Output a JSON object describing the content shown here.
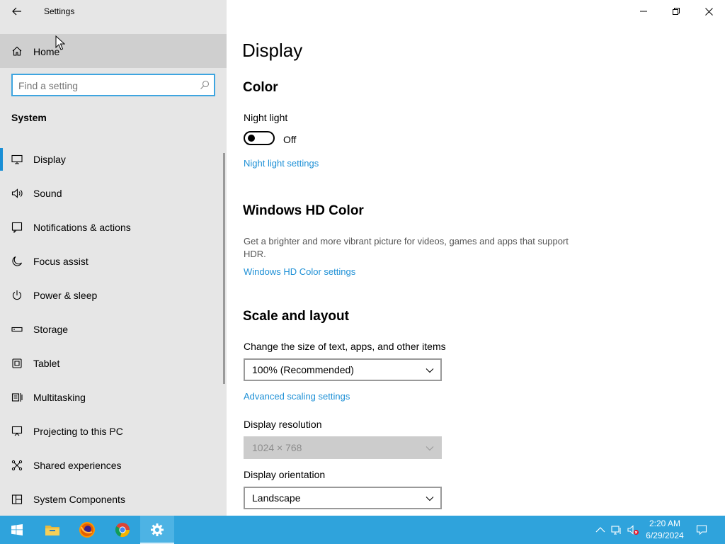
{
  "window": {
    "title": "Settings"
  },
  "sidebar": {
    "home_label": "Home",
    "search_placeholder": "Find a setting",
    "section": "System",
    "items": [
      {
        "label": "Display",
        "icon": "monitor-icon",
        "selected": true
      },
      {
        "label": "Sound",
        "icon": "speaker-icon"
      },
      {
        "label": "Notifications & actions",
        "icon": "notification-icon"
      },
      {
        "label": "Focus assist",
        "icon": "moon-icon"
      },
      {
        "label": "Power & sleep",
        "icon": "power-icon"
      },
      {
        "label": "Storage",
        "icon": "storage-icon"
      },
      {
        "label": "Tablet",
        "icon": "tablet-icon"
      },
      {
        "label": "Multitasking",
        "icon": "multitasking-icon"
      },
      {
        "label": "Projecting to this PC",
        "icon": "projecting-icon"
      },
      {
        "label": "Shared experiences",
        "icon": "shared-experiences-icon"
      },
      {
        "label": "System Components",
        "icon": "components-icon"
      }
    ]
  },
  "main": {
    "title": "Display",
    "color": {
      "heading": "Color",
      "night_light_label": "Night light",
      "night_light_state": "Off",
      "night_light_link": "Night light settings"
    },
    "hd_color": {
      "heading": "Windows HD Color",
      "description": "Get a brighter and more vibrant picture for videos, games and apps that support HDR.",
      "link": "Windows HD Color settings"
    },
    "scale_layout": {
      "heading": "Scale and layout",
      "size_label": "Change the size of text, apps, and other items",
      "size_value": "100% (Recommended)",
      "advanced_link": "Advanced scaling settings",
      "resolution_label": "Display resolution",
      "resolution_value": "1024 × 768",
      "orientation_label": "Display orientation",
      "orientation_value": "Landscape"
    }
  },
  "taskbar": {
    "apps": [
      "start-icon",
      "file-explorer-icon",
      "firefox-icon",
      "chrome-icon",
      "settings-icon"
    ],
    "active_app": "settings-icon",
    "time": "2:20 AM",
    "date": "6/29/2024"
  },
  "colors": {
    "accent": "#1e90d6",
    "taskbar": "#2fa3dc",
    "sidebar_bg": "#e6e6e6",
    "selected_bg": "#cfcfcf"
  }
}
